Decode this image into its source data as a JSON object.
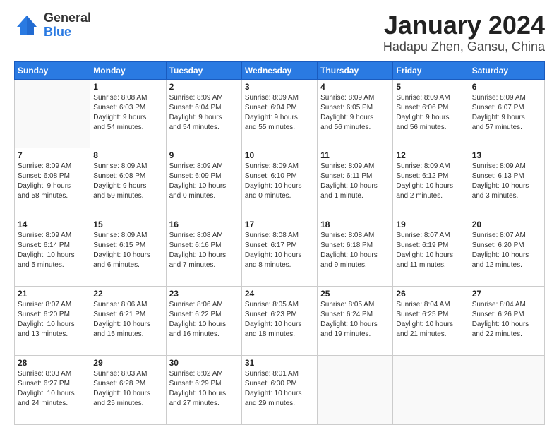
{
  "header": {
    "logo": {
      "general": "General",
      "blue": "Blue"
    },
    "title": "January 2024",
    "location": "Hadapu Zhen, Gansu, China"
  },
  "weekdays": [
    "Sunday",
    "Monday",
    "Tuesday",
    "Wednesday",
    "Thursday",
    "Friday",
    "Saturday"
  ],
  "weeks": [
    [
      {
        "day": "",
        "info": ""
      },
      {
        "day": "1",
        "info": "Sunrise: 8:08 AM\nSunset: 6:03 PM\nDaylight: 9 hours\nand 54 minutes."
      },
      {
        "day": "2",
        "info": "Sunrise: 8:09 AM\nSunset: 6:04 PM\nDaylight: 9 hours\nand 54 minutes."
      },
      {
        "day": "3",
        "info": "Sunrise: 8:09 AM\nSunset: 6:04 PM\nDaylight: 9 hours\nand 55 minutes."
      },
      {
        "day": "4",
        "info": "Sunrise: 8:09 AM\nSunset: 6:05 PM\nDaylight: 9 hours\nand 56 minutes."
      },
      {
        "day": "5",
        "info": "Sunrise: 8:09 AM\nSunset: 6:06 PM\nDaylight: 9 hours\nand 56 minutes."
      },
      {
        "day": "6",
        "info": "Sunrise: 8:09 AM\nSunset: 6:07 PM\nDaylight: 9 hours\nand 57 minutes."
      }
    ],
    [
      {
        "day": "7",
        "info": "Sunrise: 8:09 AM\nSunset: 6:08 PM\nDaylight: 9 hours\nand 58 minutes."
      },
      {
        "day": "8",
        "info": "Sunrise: 8:09 AM\nSunset: 6:08 PM\nDaylight: 9 hours\nand 59 minutes."
      },
      {
        "day": "9",
        "info": "Sunrise: 8:09 AM\nSunset: 6:09 PM\nDaylight: 10 hours\nand 0 minutes."
      },
      {
        "day": "10",
        "info": "Sunrise: 8:09 AM\nSunset: 6:10 PM\nDaylight: 10 hours\nand 0 minutes."
      },
      {
        "day": "11",
        "info": "Sunrise: 8:09 AM\nSunset: 6:11 PM\nDaylight: 10 hours\nand 1 minute."
      },
      {
        "day": "12",
        "info": "Sunrise: 8:09 AM\nSunset: 6:12 PM\nDaylight: 10 hours\nand 2 minutes."
      },
      {
        "day": "13",
        "info": "Sunrise: 8:09 AM\nSunset: 6:13 PM\nDaylight: 10 hours\nand 3 minutes."
      }
    ],
    [
      {
        "day": "14",
        "info": "Sunrise: 8:09 AM\nSunset: 6:14 PM\nDaylight: 10 hours\nand 5 minutes."
      },
      {
        "day": "15",
        "info": "Sunrise: 8:09 AM\nSunset: 6:15 PM\nDaylight: 10 hours\nand 6 minutes."
      },
      {
        "day": "16",
        "info": "Sunrise: 8:08 AM\nSunset: 6:16 PM\nDaylight: 10 hours\nand 7 minutes."
      },
      {
        "day": "17",
        "info": "Sunrise: 8:08 AM\nSunset: 6:17 PM\nDaylight: 10 hours\nand 8 minutes."
      },
      {
        "day": "18",
        "info": "Sunrise: 8:08 AM\nSunset: 6:18 PM\nDaylight: 10 hours\nand 9 minutes."
      },
      {
        "day": "19",
        "info": "Sunrise: 8:07 AM\nSunset: 6:19 PM\nDaylight: 10 hours\nand 11 minutes."
      },
      {
        "day": "20",
        "info": "Sunrise: 8:07 AM\nSunset: 6:20 PM\nDaylight: 10 hours\nand 12 minutes."
      }
    ],
    [
      {
        "day": "21",
        "info": "Sunrise: 8:07 AM\nSunset: 6:20 PM\nDaylight: 10 hours\nand 13 minutes."
      },
      {
        "day": "22",
        "info": "Sunrise: 8:06 AM\nSunset: 6:21 PM\nDaylight: 10 hours\nand 15 minutes."
      },
      {
        "day": "23",
        "info": "Sunrise: 8:06 AM\nSunset: 6:22 PM\nDaylight: 10 hours\nand 16 minutes."
      },
      {
        "day": "24",
        "info": "Sunrise: 8:05 AM\nSunset: 6:23 PM\nDaylight: 10 hours\nand 18 minutes."
      },
      {
        "day": "25",
        "info": "Sunrise: 8:05 AM\nSunset: 6:24 PM\nDaylight: 10 hours\nand 19 minutes."
      },
      {
        "day": "26",
        "info": "Sunrise: 8:04 AM\nSunset: 6:25 PM\nDaylight: 10 hours\nand 21 minutes."
      },
      {
        "day": "27",
        "info": "Sunrise: 8:04 AM\nSunset: 6:26 PM\nDaylight: 10 hours\nand 22 minutes."
      }
    ],
    [
      {
        "day": "28",
        "info": "Sunrise: 8:03 AM\nSunset: 6:27 PM\nDaylight: 10 hours\nand 24 minutes."
      },
      {
        "day": "29",
        "info": "Sunrise: 8:03 AM\nSunset: 6:28 PM\nDaylight: 10 hours\nand 25 minutes."
      },
      {
        "day": "30",
        "info": "Sunrise: 8:02 AM\nSunset: 6:29 PM\nDaylight: 10 hours\nand 27 minutes."
      },
      {
        "day": "31",
        "info": "Sunrise: 8:01 AM\nSunset: 6:30 PM\nDaylight: 10 hours\nand 29 minutes."
      },
      {
        "day": "",
        "info": ""
      },
      {
        "day": "",
        "info": ""
      },
      {
        "day": "",
        "info": ""
      }
    ]
  ]
}
